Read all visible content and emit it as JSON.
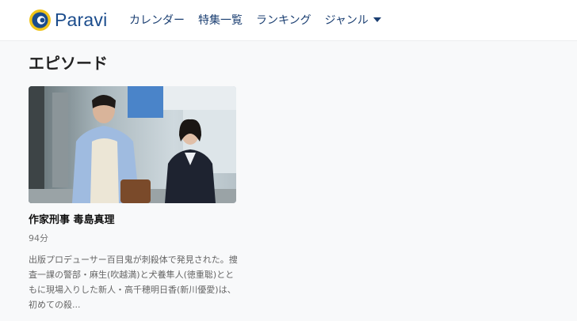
{
  "header": {
    "logo_text": "Paravi",
    "nav": [
      {
        "label": "カレンダー"
      },
      {
        "label": "特集一覧"
      },
      {
        "label": "ランキング"
      },
      {
        "label": "ジャンル"
      }
    ]
  },
  "section": {
    "title": "エピソード"
  },
  "episode": {
    "title": "作家刑事 毒島真理",
    "duration": "94分",
    "description": "出版プロデューサー百目鬼が刺殺体で発見された。捜査一課の警部・麻生(吹越満)と犬養隼人(徳重聡)とともに現場入りした新人・高千穂明日香(新川優愛)は、初めての殺..."
  },
  "colors": {
    "brand": "#1b4c8c",
    "logo_ring": "#f0c419",
    "nav_text": "#1b3f72"
  }
}
